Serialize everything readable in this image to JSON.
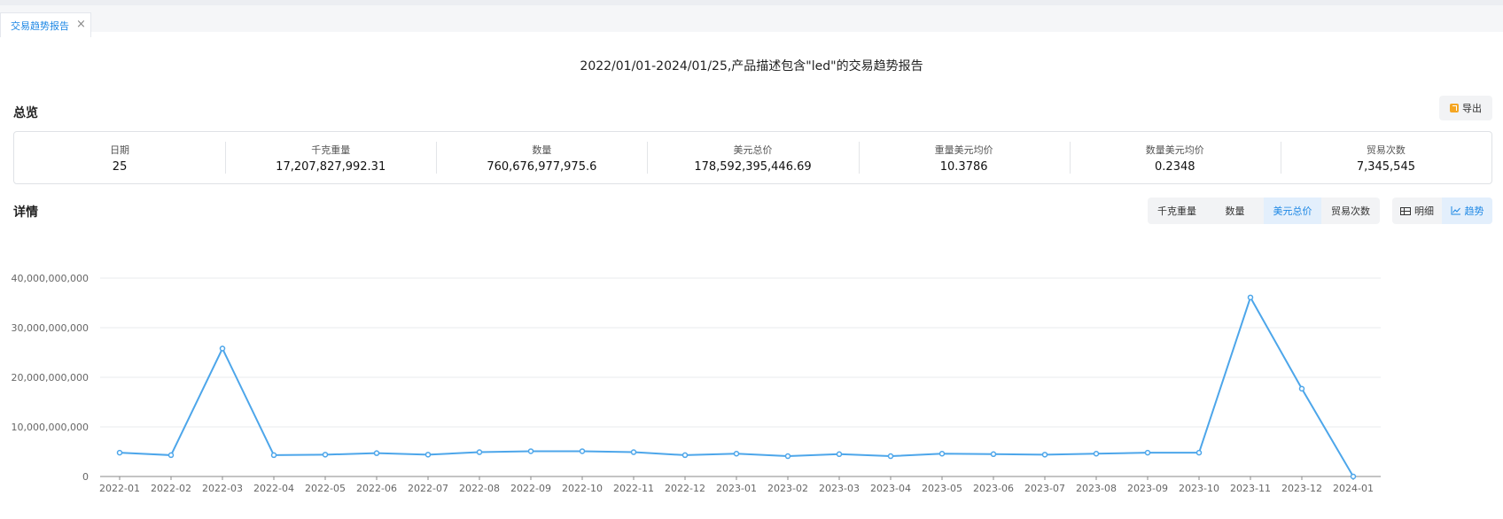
{
  "tab": {
    "label": "交易趋势报告",
    "close": "×"
  },
  "report": {
    "title": "2022/01/01-2024/01/25,产品描述包含\"led\"的交易趋势报告"
  },
  "overview": {
    "label": "总览",
    "export_label": "导出",
    "stats": [
      {
        "label": "日期",
        "value": "25"
      },
      {
        "label": "千克重量",
        "value": "17,207,827,992.31"
      },
      {
        "label": "数量",
        "value": "760,676,977,975.6"
      },
      {
        "label": "美元总价",
        "value": "178,592,395,446.69"
      },
      {
        "label": "重量美元均价",
        "value": "10.3786"
      },
      {
        "label": "数量美元均价",
        "value": "0.2348"
      },
      {
        "label": "贸易次数",
        "value": "7,345,545"
      }
    ]
  },
  "details": {
    "label": "详情",
    "metric_tabs": [
      {
        "label": "千克重量",
        "active": false
      },
      {
        "label": "数量",
        "active": false
      },
      {
        "label": "美元总价",
        "active": true
      },
      {
        "label": "贸易次数",
        "active": false
      }
    ],
    "view_tabs": [
      {
        "label": "明细",
        "icon": "table-icon",
        "active": false
      },
      {
        "label": "趋势",
        "icon": "trend-icon",
        "active": true
      }
    ]
  },
  "colors": {
    "accent": "#1e88e5",
    "line": "#4da6ea"
  },
  "chart_data": {
    "type": "line",
    "title": "",
    "xlabel": "",
    "ylabel": "",
    "ylim": [
      0,
      40000000000
    ],
    "yticks": [
      "0",
      "10,000,000,000",
      "20,000,000,000",
      "30,000,000,000",
      "40,000,000,000"
    ],
    "grid": true,
    "categories": [
      "2022-01",
      "2022-02",
      "2022-03",
      "2022-04",
      "2022-05",
      "2022-06",
      "2022-07",
      "2022-08",
      "2022-09",
      "2022-10",
      "2022-11",
      "2022-12",
      "2023-01",
      "2023-02",
      "2023-03",
      "2023-04",
      "2023-05",
      "2023-06",
      "2023-07",
      "2023-08",
      "2023-09",
      "2023-10",
      "2023-11",
      "2023-12",
      "2024-01"
    ],
    "series": [
      {
        "values": [
          4800000000,
          4300000000,
          25800000000,
          4300000000,
          4400000000,
          4700000000,
          4400000000,
          4900000000,
          5100000000,
          5100000000,
          4900000000,
          4300000000,
          4600000000,
          4100000000,
          4500000000,
          4100000000,
          4600000000,
          4500000000,
          4400000000,
          4600000000,
          4800000000,
          4800000000,
          36100000000,
          17700000000,
          0
        ]
      }
    ]
  }
}
